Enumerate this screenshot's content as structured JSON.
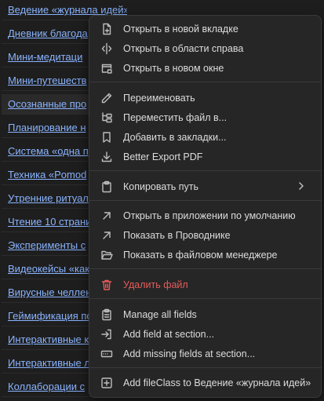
{
  "files": [
    "Ведение «журнала идей»",
    "Дневник благода",
    "Мини-медитаци",
    "Мини-путешеств",
    "Осознанные про",
    "Планирование н",
    "Система «одна пр",
    "Техника «Pomod",
    "Утренние ритуал",
    "Чтение 10 страни",
    "Эксперименты с",
    "Видеокейсы «как",
    "Вирусные челлен",
    "Геймификация по",
    "Интерактивные к",
    "Интерактивные л",
    "Коллаборации с"
  ],
  "menu": {
    "open_new_tab": "Открыть в новой вкладке",
    "open_right": "Открыть в области справа",
    "open_new_window": "Открыть в новом окне",
    "rename": "Переименовать",
    "move_file": "Переместить файл в...",
    "add_bookmark": "Добавить в закладки...",
    "better_export_pdf": "Better Export PDF",
    "copy_path": "Копировать путь",
    "open_default_app": "Открыть в приложении по умолчанию",
    "show_in_explorer": "Показать в Проводнике",
    "show_in_file_manager": "Показать в файловом менеджере",
    "delete_file": "Удалить файл",
    "manage_all_fields": "Manage all fields",
    "add_field_at_section": "Add field at section...",
    "add_missing_fields": "Add missing fields at section...",
    "add_fileclass": "Add fileClass to Ведение «журнала идей»"
  },
  "colors": {
    "background": "#1e1e1e",
    "menu_background": "#262626",
    "link": "#8ab4ff",
    "danger": "#e55c5c",
    "text": "#dcdcdc"
  }
}
